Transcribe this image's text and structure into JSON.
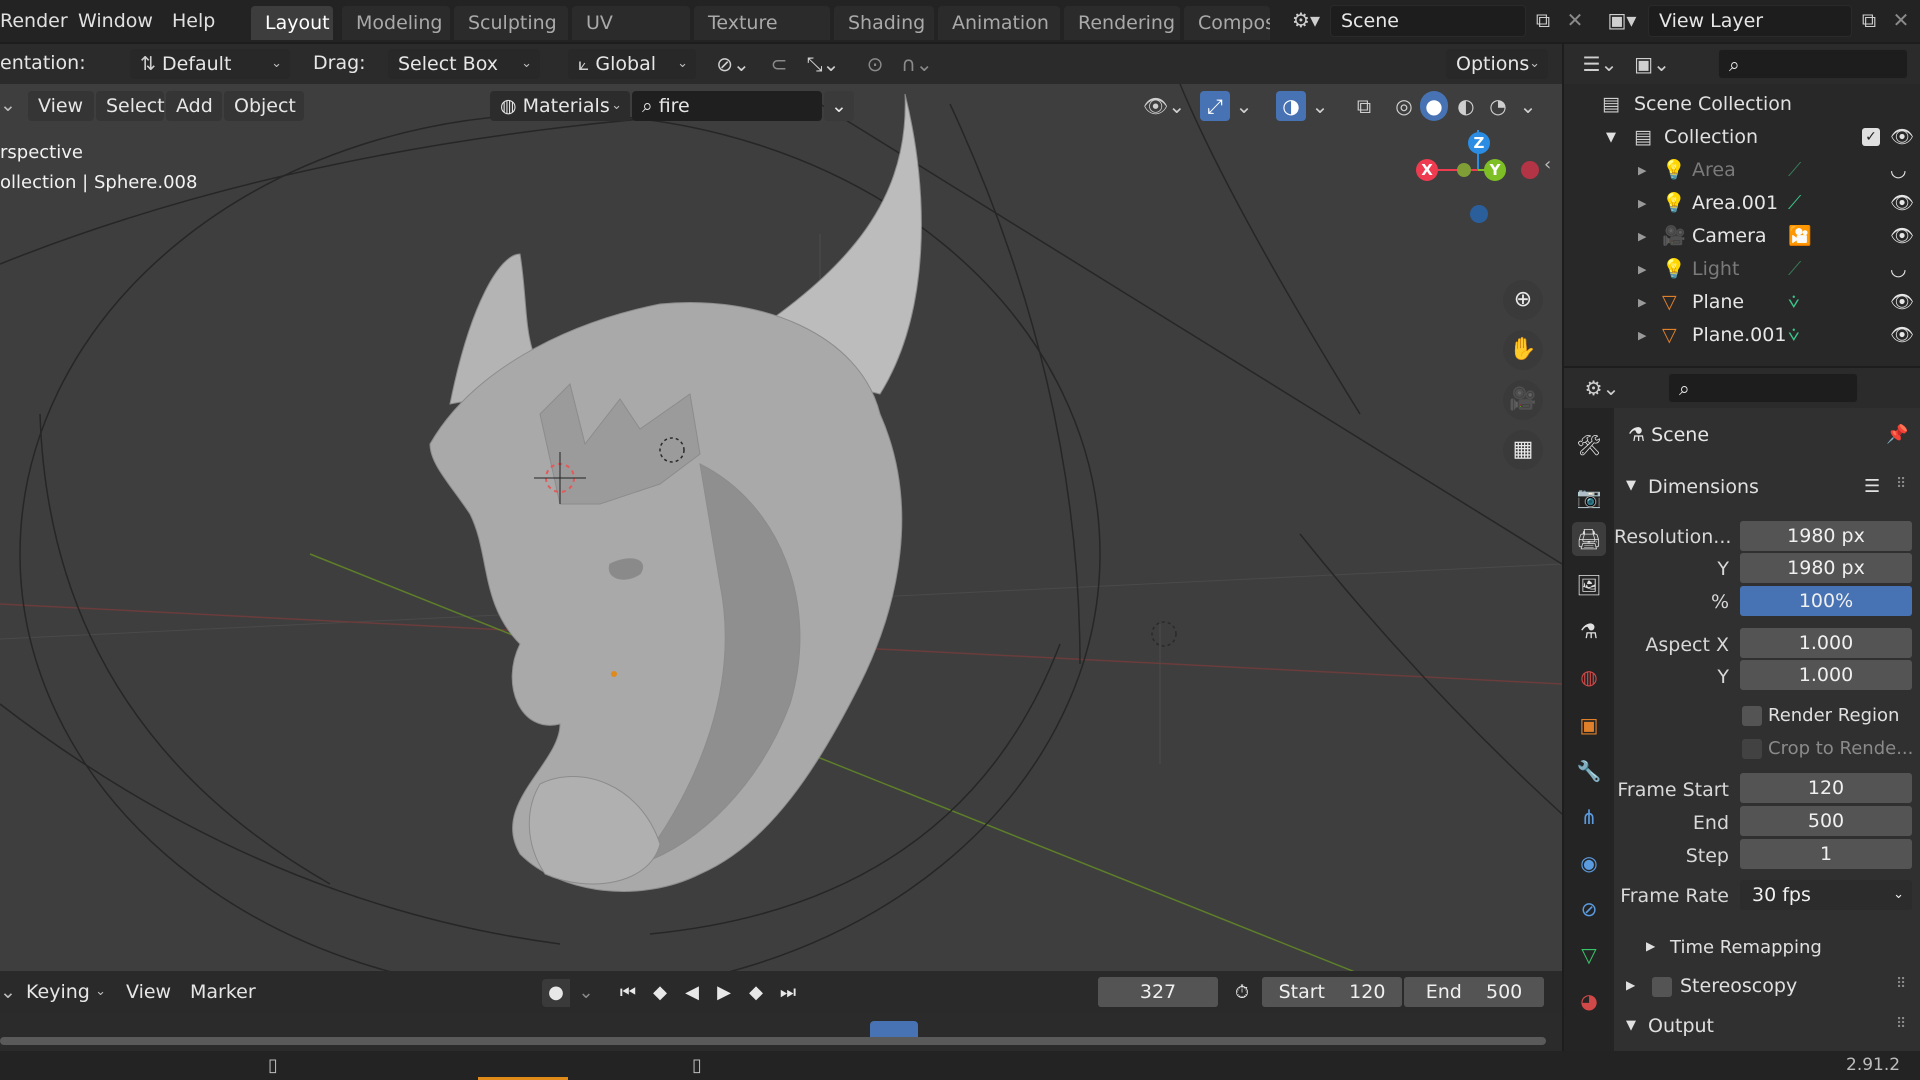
{
  "topbar": {
    "menus": [
      "Render",
      "Window",
      "Help"
    ],
    "workspace_tabs": [
      "Layout",
      "Modeling",
      "Sculpting",
      "UV Editing",
      "Texture Paint",
      "Shading",
      "Animation",
      "Rendering",
      "Compos"
    ],
    "active_tab": "Layout",
    "scene_name": "Scene",
    "view_layer": "View Layer"
  },
  "tool_header": {
    "orientation_label": "entation:",
    "orientation_value": "Default",
    "drag_label": "Drag:",
    "drag_value": "Select Box",
    "transform_value": "Global",
    "options_label": "Options"
  },
  "viewport_header": {
    "menus": [
      "View",
      "Select",
      "Add",
      "Object"
    ],
    "shading_dropdown": "Materials",
    "search_value": "fire"
  },
  "viewport": {
    "overlay_line1": "rspective",
    "overlay_line2": "ollection | Sphere.008",
    "gizmo": {
      "x": "X",
      "y": "Y",
      "z": "Z"
    }
  },
  "outliner": {
    "root": "Scene Collection",
    "collection": "Collection",
    "items": [
      {
        "name": "Area",
        "icon": "light-icon",
        "data_icon": "light-data-icon",
        "dimmed": true,
        "visible": false
      },
      {
        "name": "Area.001",
        "icon": "light-icon",
        "data_icon": "light-data-icon",
        "dimmed": false,
        "visible": true
      },
      {
        "name": "Camera",
        "icon": "camera-icon",
        "data_icon": "camera-data-icon",
        "dimmed": false,
        "visible": true
      },
      {
        "name": "Light",
        "icon": "light-icon",
        "data_icon": "light-data-icon",
        "dimmed": true,
        "visible": false
      },
      {
        "name": "Plane",
        "icon": "mesh-icon",
        "data_icon": "mesh-data-icon",
        "dimmed": false,
        "visible": true
      },
      {
        "name": "Plane.001",
        "icon": "mesh-icon",
        "data_icon": "mesh-data-icon",
        "dimmed": false,
        "visible": true
      }
    ]
  },
  "properties": {
    "context": "Scene",
    "dimensions_label": "Dimensions",
    "resolution_label": "Resolution...",
    "res_x": "1980 px",
    "y_label": "Y",
    "res_y": "1980 px",
    "pct_label": "%",
    "res_pct": "100%",
    "aspect_label": "Aspect X",
    "aspect_x": "1.000",
    "aspect_y": "1.000",
    "render_region": "Render Region",
    "crop_label": "Crop to Rende...",
    "frame_start_label": "Frame Start",
    "frame_start": "120",
    "end_label": "End",
    "frame_end": "500",
    "step_label": "Step",
    "frame_step": "1",
    "frame_rate_label": "Frame Rate",
    "frame_rate": "30 fps",
    "time_remapping": "Time Remapping",
    "stereoscopy": "Stereoscopy",
    "output": "Output"
  },
  "timeline": {
    "keying": "Keying",
    "view": "View",
    "marker": "Marker",
    "current_frame": "327",
    "start_label": "Start",
    "start_value": "120",
    "end_label": "End",
    "end_value": "500"
  },
  "status": {
    "version": "2.91.2"
  },
  "colors": {
    "accent": "#4772b3",
    "axis_x": "#ee3b4f",
    "axis_y": "#7fbf26",
    "axis_z": "#2b8ce3",
    "header": "#303030",
    "viewport_bg": "#3e3e3e"
  }
}
